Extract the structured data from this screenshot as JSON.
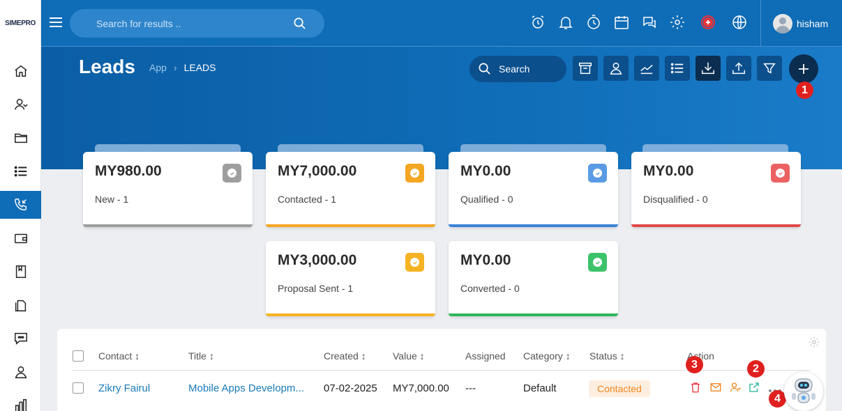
{
  "app": {
    "logo_main": "SIMEPRO",
    "user_name": "hisham"
  },
  "search": {
    "placeholder": "Search for results .."
  },
  "page": {
    "title": "Leads",
    "breadcrumb": [
      "App",
      "LEADS"
    ],
    "search_label": "Search"
  },
  "colors": {
    "primary": "#0f6cb6",
    "dark_button": "#0a2d50",
    "marker": "#e0201f"
  },
  "cards": [
    {
      "amount": "MY980.00",
      "label": "New - 1",
      "color": "#9e9e9e"
    },
    {
      "amount": "MY7,000.00",
      "label": "Contacted - 1",
      "color": "#f5a623"
    },
    {
      "amount": "MY0.00",
      "label": "Qualified - 0",
      "color": "#3b82d6"
    },
    {
      "amount": "MY0.00",
      "label": "Disqualified - 0",
      "color": "#e04848"
    },
    {
      "amount": "MY3,000.00",
      "label": "Proposal Sent - 1",
      "color": "#f5b323"
    },
    {
      "amount": "MY0.00",
      "label": "Converted - 0",
      "color": "#2fb85c"
    }
  ],
  "table": {
    "headers": {
      "contact": "Contact ↕",
      "title": "Title ↕",
      "created": "Created ↕",
      "value": "Value ↕",
      "assigned": "Assigned",
      "category": "Category ↕",
      "status": "Status ↕",
      "action": "Action"
    },
    "rows": [
      {
        "contact": "Zikry Fairul",
        "title": "Mobile Apps Developm...",
        "created": "07-02-2025",
        "value": "MY7,000.00",
        "assigned": "---",
        "category": "Default",
        "status": "Contacted"
      }
    ]
  },
  "markers": [
    "1",
    "2",
    "3",
    "4"
  ]
}
